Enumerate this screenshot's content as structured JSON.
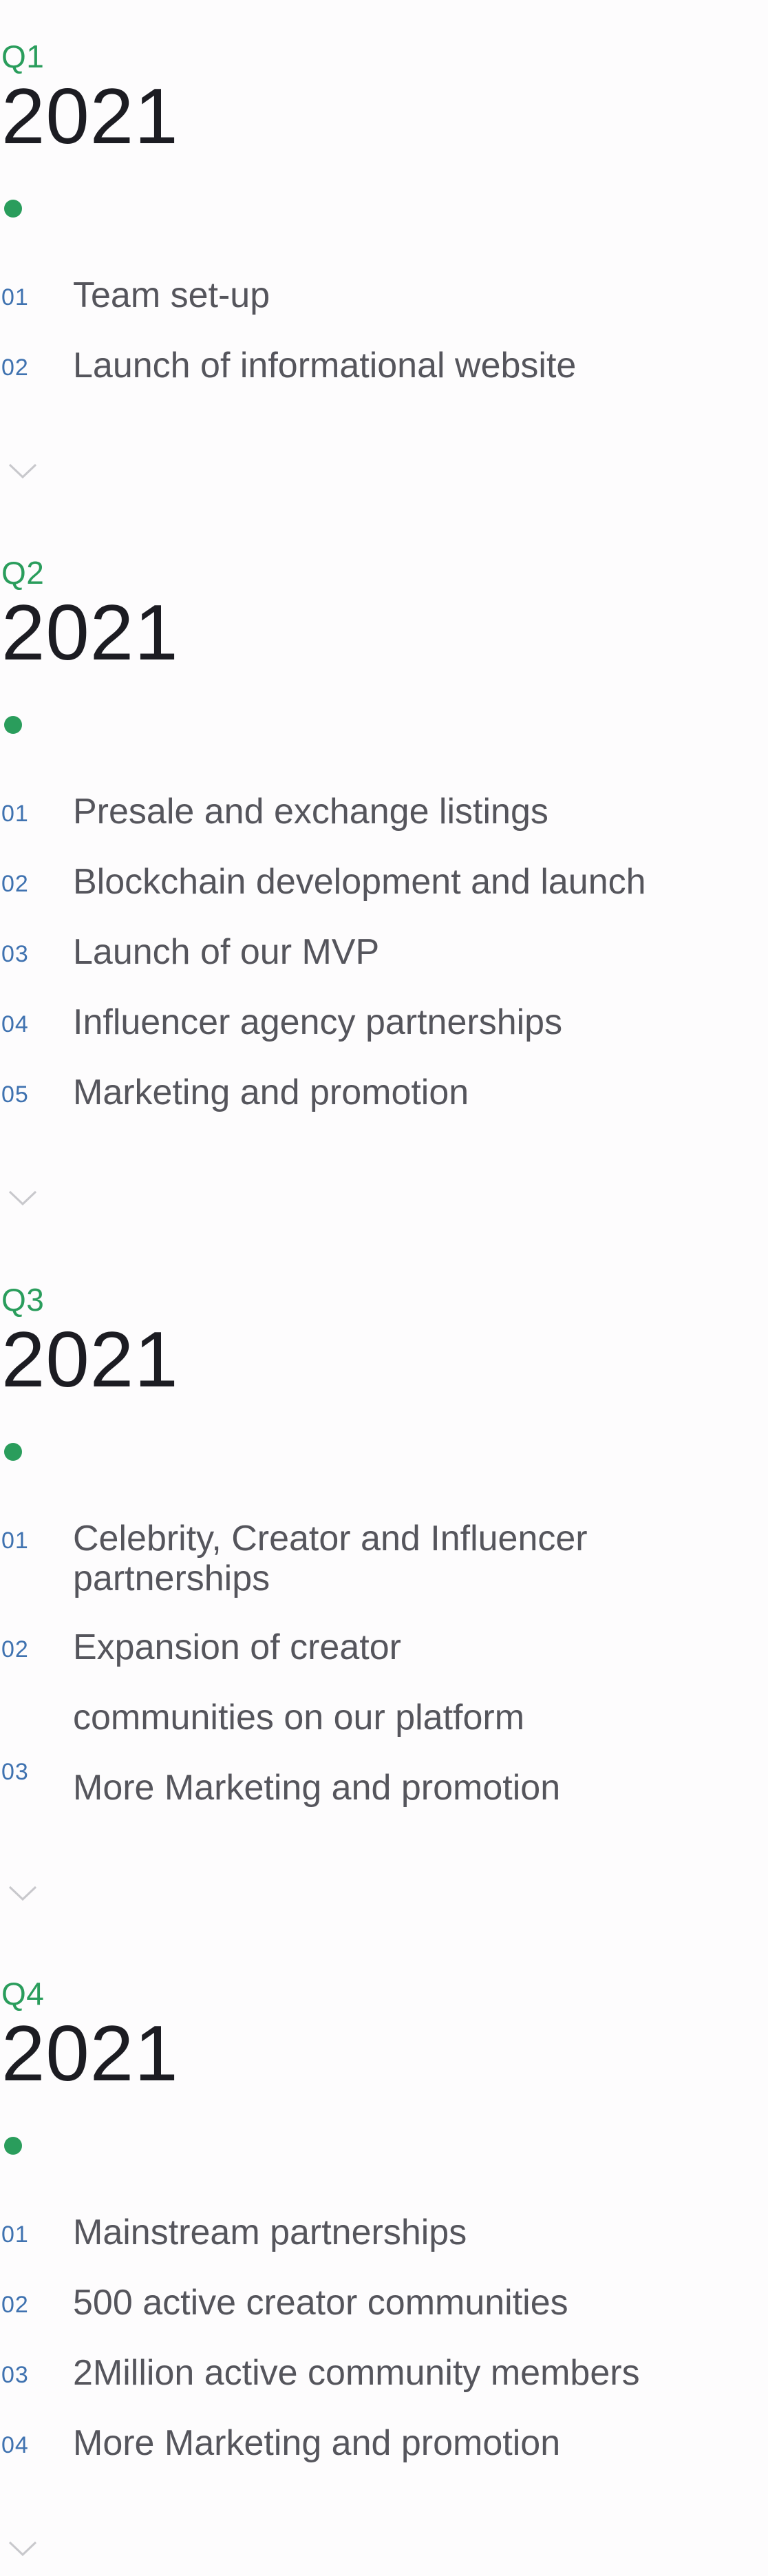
{
  "roadmap": {
    "quarters": [
      {
        "label": "Q1",
        "year": "2021",
        "items": [
          {
            "num": "01",
            "text": "Team set-up"
          },
          {
            "num": "02",
            "text": "Launch of informational website"
          }
        ]
      },
      {
        "label": "Q2",
        "year": "2021",
        "items": [
          {
            "num": "01",
            "text": "Presale and exchange listings"
          },
          {
            "num": "02",
            "text": "Blockchain development and launch"
          },
          {
            "num": "03",
            "text": "Launch of our MVP"
          },
          {
            "num": "04",
            "text": "Influencer agency partnerships"
          },
          {
            "num": "05",
            "text": "Marketing and promotion"
          }
        ]
      },
      {
        "label": "Q3",
        "year": "2021",
        "items": [
          {
            "num": "01",
            "text": "Celebrity, Creator and Influencer partnerships"
          },
          {
            "num": "02",
            "text": "Expansion of creator"
          },
          {
            "num": "",
            "text": "communities on our platform"
          },
          {
            "num": "03",
            "text": "More Marketing and promotion"
          }
        ]
      },
      {
        "label": "Q4",
        "year": "2021",
        "items": [
          {
            "num": "01",
            "text": "Mainstream partnerships"
          },
          {
            "num": "02",
            "text": "500 active creator communities"
          },
          {
            "num": "03",
            "text": "2Million active community members"
          },
          {
            "num": "04",
            "text": "More Marketing and promotion"
          }
        ]
      }
    ],
    "icons": {
      "timeline_dot": "dot-icon",
      "expand": "chevron-down-icon"
    },
    "colors": {
      "accent_green": "#2a9d5c",
      "number_blue": "#3f72b0",
      "item_text": "#55555c",
      "year_text": "#1c1c22",
      "chevron": "#c8c8cc"
    }
  }
}
